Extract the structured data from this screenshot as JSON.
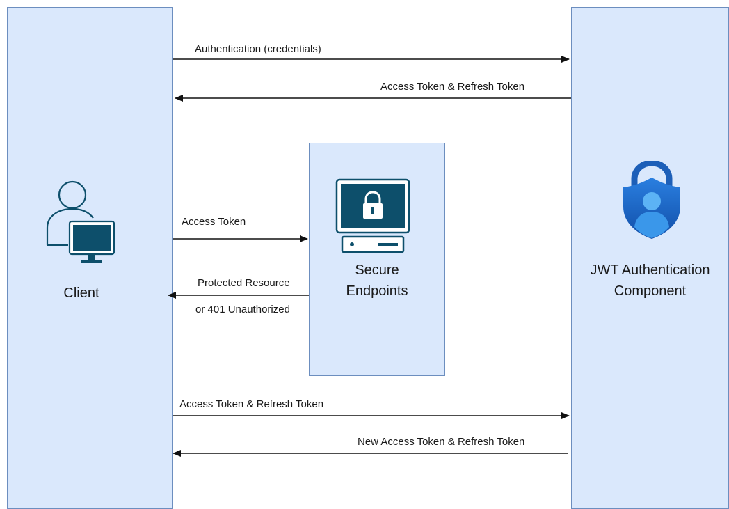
{
  "nodes": {
    "client": {
      "label": "Client"
    },
    "secure_endpoints": {
      "label_line1": "Secure",
      "label_line2": "Endpoints"
    },
    "jwt_component": {
      "label_line1": "JWT Authentication",
      "label_line2": "Component"
    }
  },
  "messages": {
    "auth_credentials": "Authentication (credentials)",
    "access_refresh_response": "Access Token & Refresh Token",
    "access_token": "Access Token",
    "protected_resource_line1": "Protected Resource",
    "protected_resource_line2": "or 401 Unauthorized",
    "access_refresh_request": "Access Token & Refresh Token",
    "new_tokens": "New Access Token & Refresh Token"
  },
  "icons": {
    "client": "user-with-monitor-icon",
    "secure_endpoints": "locked-computer-icon",
    "jwt_component": "security-shield-user-icon"
  },
  "colors": {
    "lane_fill": "#dae8fc",
    "lane_border": "#6c8ebf",
    "icon_dark_teal": "#0d4f6b",
    "shield_blue": "#1f6fd1",
    "shield_light": "#50a6f0"
  }
}
